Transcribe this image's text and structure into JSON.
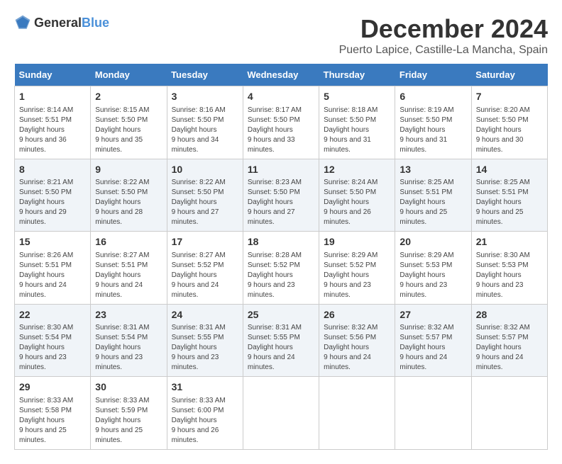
{
  "logo": {
    "text_general": "General",
    "text_blue": "Blue"
  },
  "title": "December 2024",
  "subtitle": "Puerto Lapice, Castille-La Mancha, Spain",
  "days_of_week": [
    "Sunday",
    "Monday",
    "Tuesday",
    "Wednesday",
    "Thursday",
    "Friday",
    "Saturday"
  ],
  "weeks": [
    [
      {
        "day": "1",
        "sunrise": "8:14 AM",
        "sunset": "5:51 PM",
        "daylight": "9 hours and 36 minutes."
      },
      {
        "day": "2",
        "sunrise": "8:15 AM",
        "sunset": "5:50 PM",
        "daylight": "9 hours and 35 minutes."
      },
      {
        "day": "3",
        "sunrise": "8:16 AM",
        "sunset": "5:50 PM",
        "daylight": "9 hours and 34 minutes."
      },
      {
        "day": "4",
        "sunrise": "8:17 AM",
        "sunset": "5:50 PM",
        "daylight": "9 hours and 33 minutes."
      },
      {
        "day": "5",
        "sunrise": "8:18 AM",
        "sunset": "5:50 PM",
        "daylight": "9 hours and 31 minutes."
      },
      {
        "day": "6",
        "sunrise": "8:19 AM",
        "sunset": "5:50 PM",
        "daylight": "9 hours and 31 minutes."
      },
      {
        "day": "7",
        "sunrise": "8:20 AM",
        "sunset": "5:50 PM",
        "daylight": "9 hours and 30 minutes."
      }
    ],
    [
      {
        "day": "8",
        "sunrise": "8:21 AM",
        "sunset": "5:50 PM",
        "daylight": "9 hours and 29 minutes."
      },
      {
        "day": "9",
        "sunrise": "8:22 AM",
        "sunset": "5:50 PM",
        "daylight": "9 hours and 28 minutes."
      },
      {
        "day": "10",
        "sunrise": "8:22 AM",
        "sunset": "5:50 PM",
        "daylight": "9 hours and 27 minutes."
      },
      {
        "day": "11",
        "sunrise": "8:23 AM",
        "sunset": "5:50 PM",
        "daylight": "9 hours and 27 minutes."
      },
      {
        "day": "12",
        "sunrise": "8:24 AM",
        "sunset": "5:50 PM",
        "daylight": "9 hours and 26 minutes."
      },
      {
        "day": "13",
        "sunrise": "8:25 AM",
        "sunset": "5:51 PM",
        "daylight": "9 hours and 25 minutes."
      },
      {
        "day": "14",
        "sunrise": "8:25 AM",
        "sunset": "5:51 PM",
        "daylight": "9 hours and 25 minutes."
      }
    ],
    [
      {
        "day": "15",
        "sunrise": "8:26 AM",
        "sunset": "5:51 PM",
        "daylight": "9 hours and 24 minutes."
      },
      {
        "day": "16",
        "sunrise": "8:27 AM",
        "sunset": "5:51 PM",
        "daylight": "9 hours and 24 minutes."
      },
      {
        "day": "17",
        "sunrise": "8:27 AM",
        "sunset": "5:52 PM",
        "daylight": "9 hours and 24 minutes."
      },
      {
        "day": "18",
        "sunrise": "8:28 AM",
        "sunset": "5:52 PM",
        "daylight": "9 hours and 23 minutes."
      },
      {
        "day": "19",
        "sunrise": "8:29 AM",
        "sunset": "5:52 PM",
        "daylight": "9 hours and 23 minutes."
      },
      {
        "day": "20",
        "sunrise": "8:29 AM",
        "sunset": "5:53 PM",
        "daylight": "9 hours and 23 minutes."
      },
      {
        "day": "21",
        "sunrise": "8:30 AM",
        "sunset": "5:53 PM",
        "daylight": "9 hours and 23 minutes."
      }
    ],
    [
      {
        "day": "22",
        "sunrise": "8:30 AM",
        "sunset": "5:54 PM",
        "daylight": "9 hours and 23 minutes."
      },
      {
        "day": "23",
        "sunrise": "8:31 AM",
        "sunset": "5:54 PM",
        "daylight": "9 hours and 23 minutes."
      },
      {
        "day": "24",
        "sunrise": "8:31 AM",
        "sunset": "5:55 PM",
        "daylight": "9 hours and 23 minutes."
      },
      {
        "day": "25",
        "sunrise": "8:31 AM",
        "sunset": "5:55 PM",
        "daylight": "9 hours and 24 minutes."
      },
      {
        "day": "26",
        "sunrise": "8:32 AM",
        "sunset": "5:56 PM",
        "daylight": "9 hours and 24 minutes."
      },
      {
        "day": "27",
        "sunrise": "8:32 AM",
        "sunset": "5:57 PM",
        "daylight": "9 hours and 24 minutes."
      },
      {
        "day": "28",
        "sunrise": "8:32 AM",
        "sunset": "5:57 PM",
        "daylight": "9 hours and 24 minutes."
      }
    ],
    [
      {
        "day": "29",
        "sunrise": "8:33 AM",
        "sunset": "5:58 PM",
        "daylight": "9 hours and 25 minutes."
      },
      {
        "day": "30",
        "sunrise": "8:33 AM",
        "sunset": "5:59 PM",
        "daylight": "9 hours and 25 minutes."
      },
      {
        "day": "31",
        "sunrise": "8:33 AM",
        "sunset": "6:00 PM",
        "daylight": "9 hours and 26 minutes."
      },
      null,
      null,
      null,
      null
    ]
  ],
  "labels": {
    "sunrise": "Sunrise:",
    "sunset": "Sunset:",
    "daylight": "Daylight hours"
  }
}
